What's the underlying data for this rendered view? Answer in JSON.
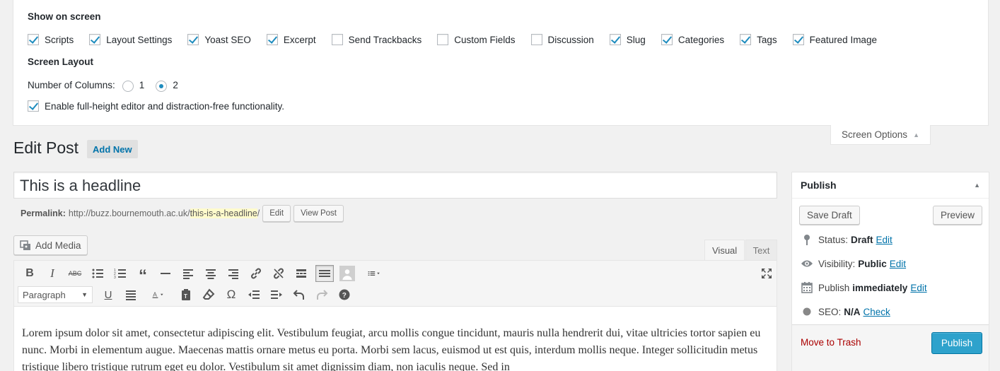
{
  "screen_options": {
    "show_on_screen_heading": "Show on screen",
    "checkboxes": [
      {
        "label": "Scripts",
        "checked": true
      },
      {
        "label": "Layout Settings",
        "checked": true
      },
      {
        "label": "Yoast SEO",
        "checked": true
      },
      {
        "label": "Excerpt",
        "checked": true
      },
      {
        "label": "Send Trackbacks",
        "checked": false
      },
      {
        "label": "Custom Fields",
        "checked": false
      },
      {
        "label": "Discussion",
        "checked": false
      },
      {
        "label": "Slug",
        "checked": true
      },
      {
        "label": "Categories",
        "checked": true
      },
      {
        "label": "Tags",
        "checked": true
      },
      {
        "label": "Featured Image",
        "checked": true
      }
    ],
    "layout_heading": "Screen Layout",
    "columns_label": "Number of Columns:",
    "column_options": [
      {
        "label": "1",
        "checked": false
      },
      {
        "label": "2",
        "checked": true
      }
    ],
    "full_height_label": "Enable full-height editor and distraction-free functionality.",
    "full_height_checked": true,
    "tab_label": "Screen Options"
  },
  "page": {
    "title": "Edit Post",
    "add_new": "Add New"
  },
  "post": {
    "title_value": "This is a headline",
    "permalink_label": "Permalink:",
    "permalink_base": "http://buzz.bournemouth.ac.uk/",
    "permalink_slug": "this-is-a-headline",
    "permalink_trailing": "/",
    "edit_button": "Edit",
    "view_button": "View Post"
  },
  "editor": {
    "add_media": "Add Media",
    "tab_visual": "Visual",
    "tab_text": "Text",
    "format_value": "Paragraph",
    "content": "Lorem ipsum dolor sit amet, consectetur adipiscing elit. Vestibulum feugiat, arcu mollis congue tincidunt, mauris nulla hendrerit dui, vitae ultricies tortor sapien eu nunc. Morbi in elementum augue. Maecenas mattis ornare metus eu porta. Morbi sem lacus, euismod ut est quis, interdum mollis neque. Integer sollicitudin metus tristique libero tristique rutrum eget eu dolor. Vestibulum sit amet dignissim diam, non iaculis neque. Sed in"
  },
  "publish": {
    "heading": "Publish",
    "save_draft": "Save Draft",
    "preview": "Preview",
    "status_label": "Status:",
    "status_value": "Draft",
    "visibility_label": "Visibility:",
    "visibility_value": "Public",
    "schedule_label": "Publish",
    "schedule_value": "immediately",
    "seo_label": "SEO:",
    "seo_value": "N/A",
    "seo_link": "Check",
    "edit_link": "Edit",
    "move_to_trash": "Move to Trash",
    "publish_button": "Publish"
  }
}
